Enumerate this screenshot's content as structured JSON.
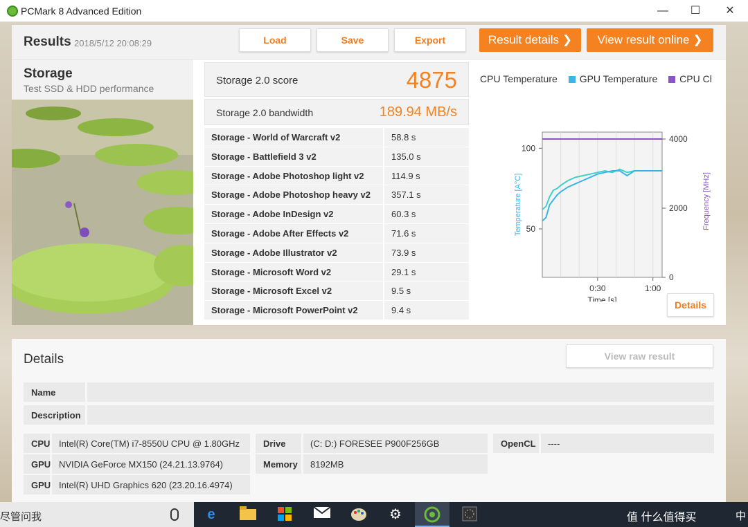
{
  "window": {
    "title": "PCMark 8 Advanced Edition",
    "minimize": "—",
    "maximize": "☐",
    "close": "✕"
  },
  "results": {
    "title": "Results",
    "date": "2018/5/12 20:08:29",
    "load_label": "Load",
    "save_label": "Save",
    "export_label": "Export",
    "result_details_label": "Result details ❯",
    "view_online_label": "View result online ❯"
  },
  "storage": {
    "title": "Storage",
    "subtitle": "Test SSD & HDD performance",
    "score_label": "Storage 2.0 score",
    "score_value": "4875",
    "bandwidth_label": "Storage 2.0 bandwidth",
    "bandwidth_value": "189.94 MB/s",
    "tests": [
      {
        "name": "Storage - World of Warcraft v2",
        "value": "58.8 s"
      },
      {
        "name": "Storage - Battlefield 3 v2",
        "value": "135.0 s"
      },
      {
        "name": "Storage - Adobe Photoshop light v2",
        "value": "114.9 s"
      },
      {
        "name": "Storage - Adobe Photoshop heavy v2",
        "value": "357.1 s"
      },
      {
        "name": "Storage - Adobe InDesign v2",
        "value": "60.3 s"
      },
      {
        "name": "Storage - Adobe After Effects v2",
        "value": "71.6 s"
      },
      {
        "name": "Storage - Adobe Illustrator v2",
        "value": "73.9 s"
      },
      {
        "name": "Storage - Microsoft Word v2",
        "value": "29.1 s"
      },
      {
        "name": "Storage - Microsoft Excel v2",
        "value": "9.5 s"
      },
      {
        "name": "Storage - Microsoft PowerPoint v2",
        "value": "9.4 s"
      }
    ]
  },
  "chart_data": {
    "type": "line",
    "legend": [
      "CPU Temperature",
      "GPU Temperature",
      "CPU Cl"
    ],
    "xlabel": "Time [s]",
    "ylabel_left": "Temperature [A°C]",
    "ylabel_right": "Frequency [MHz]",
    "x_ticks": [
      "0:30",
      "1:00"
    ],
    "y_left_ticks": [
      "100",
      "50"
    ],
    "y_right_ticks": [
      "4000",
      "2000",
      "0"
    ],
    "xlim": [
      0,
      65
    ],
    "ylim_left": [
      20,
      110
    ],
    "ylim_right": [
      0,
      4000
    ],
    "colors": {
      "cpu_temp": "#3fd0c8",
      "gpu_temp": "#3bb4e6",
      "cpu_clock": "#8a55c9"
    },
    "series": [
      {
        "name": "CPU Temperature",
        "axis": "left",
        "color": "#3fd0c8",
        "x": [
          0,
          2,
          4,
          6,
          8,
          10,
          14,
          18,
          22,
          26,
          30,
          34,
          38,
          42,
          46,
          50,
          54,
          58,
          62,
          65
        ],
        "y": [
          62,
          64,
          70,
          74,
          75,
          77,
          80,
          82,
          83,
          84,
          85,
          86,
          85,
          87,
          85,
          86,
          86,
          86,
          86,
          86
        ]
      },
      {
        "name": "GPU Temperature",
        "axis": "left",
        "color": "#3bb4e6",
        "x": [
          0,
          2,
          4,
          6,
          8,
          10,
          14,
          18,
          22,
          26,
          30,
          34,
          38,
          42,
          46,
          50,
          54,
          58,
          62,
          65
        ],
        "y": [
          55,
          57,
          65,
          68,
          71,
          73,
          76,
          78,
          80,
          82,
          84,
          85,
          86,
          86,
          83,
          86,
          86,
          86,
          86,
          86
        ]
      },
      {
        "name": "CPU Cl",
        "axis": "right",
        "color": "#8a55c9",
        "x": [
          0,
          10,
          20,
          30,
          40,
          50,
          60,
          65
        ],
        "y": [
          4000,
          4000,
          4000,
          4000,
          4000,
          4000,
          4000,
          4000
        ]
      }
    ],
    "details_label": "Details"
  },
  "details": {
    "title": "Details",
    "view_raw_label": "View raw result",
    "name_label": "Name",
    "name_value": "",
    "description_label": "Description",
    "description_value": "",
    "cpu_label": "CPU",
    "cpu_value": "Intel(R) Core(TM) i7-8550U CPU @ 1.80GHz",
    "gpu1_label": "GPU",
    "gpu1_value": "NVIDIA GeForce MX150 (24.21.13.9764)",
    "gpu2_label": "GPU",
    "gpu2_value": "Intel(R) UHD Graphics 620 (23.20.16.4974)",
    "drive_label": "Drive",
    "drive_value": "(C: D:) FORESEE P900F256GB",
    "memory_label": "Memory",
    "memory_value": "8192MB",
    "opencl_label": "OpenCL",
    "opencl_value": "----"
  },
  "taskbar": {
    "search_text": "尽管问我",
    "tray_text": "值 什么值得买",
    "ime": "中"
  }
}
